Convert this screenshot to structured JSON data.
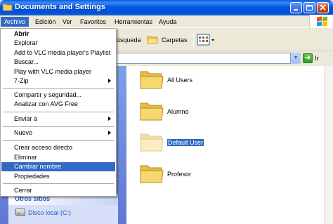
{
  "window": {
    "title": "Documents and Settings"
  },
  "menubar": {
    "items": [
      "Archivo",
      "Edición",
      "Ver",
      "Favoritos",
      "Herramientas",
      "Ayuda"
    ]
  },
  "toolbar": {
    "search_label": "úsqueda",
    "folders_label": "Carpetas"
  },
  "addressbar": {
    "go_label": "Ir"
  },
  "file_menu": {
    "items": [
      {
        "label": "Abrir",
        "bold": true
      },
      {
        "label": "Explorar"
      },
      {
        "label": "Add to VLC media player's Playlist"
      },
      {
        "label": "Buscar..."
      },
      {
        "label": "Play with VLC media player"
      },
      {
        "label": "7-Zip",
        "submenu": true
      },
      {
        "label": "Compartir y seguridad..."
      },
      {
        "label": "Analizar con AVG Free"
      },
      {
        "label": "Enviar a",
        "submenu": true
      },
      {
        "label": "Nuevo",
        "submenu": true
      },
      {
        "label": "Crear acceso directo"
      },
      {
        "label": "Eliminar"
      },
      {
        "label": "Cambiar nombre",
        "highlighted": true
      },
      {
        "label": "Propiedades"
      },
      {
        "label": "Cerrar"
      }
    ]
  },
  "taskpane": {
    "other_places_title": "Otros sitios",
    "links": [
      "Disco local (C:)"
    ]
  },
  "folders": [
    {
      "name": "All Users"
    },
    {
      "name": "Alumno"
    },
    {
      "name": "Default User",
      "selected": true
    },
    {
      "name": "Profesor"
    }
  ],
  "colors": {
    "titlebar": "#0058E6",
    "selection": "#316AC5",
    "menu_bg": "#ECE9D8",
    "folder": "#F5D66B"
  }
}
